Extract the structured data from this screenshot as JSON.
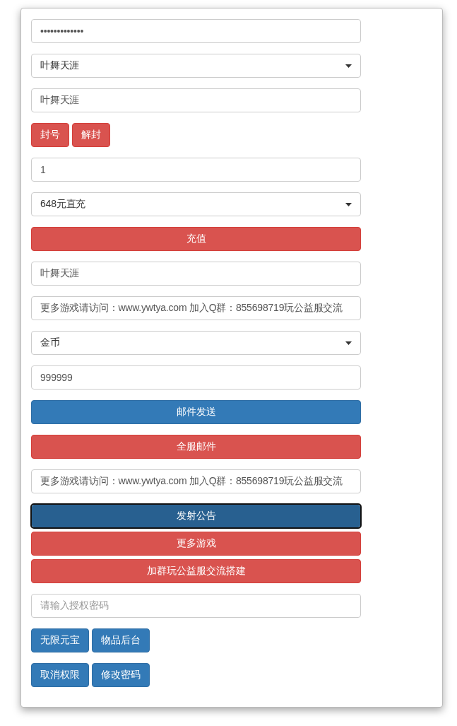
{
  "form": {
    "rows": [
      {
        "kind": "field",
        "value": "•••••••••••••"
      },
      {
        "kind": "select",
        "value": "叶舞天涯"
      },
      {
        "kind": "field",
        "value": "叶舞天涯"
      },
      {
        "kind": "buttons",
        "buttons": [
          {
            "label": "封号",
            "kind": "danger"
          },
          {
            "label": "解封",
            "kind": "danger"
          }
        ]
      },
      {
        "kind": "field",
        "value": "1"
      },
      {
        "kind": "select",
        "value": "648元直充"
      },
      {
        "kind": "stack",
        "buttons": [
          {
            "label": "充值",
            "kind": "danger",
            "focused": false
          }
        ]
      },
      {
        "kind": "field",
        "value": "叶舞天涯"
      },
      {
        "kind": "field",
        "value": "更多游戏请访问：www.ywtya.com  加入Q群：855698719玩公益服交流"
      },
      {
        "kind": "select",
        "value": "金币"
      },
      {
        "kind": "field",
        "value": "999999"
      },
      {
        "kind": "stack",
        "buttons": [
          {
            "label": "邮件发送",
            "kind": "primary",
            "focused": false
          }
        ]
      },
      {
        "kind": "stack",
        "buttons": [
          {
            "label": "全服邮件",
            "kind": "danger",
            "focused": false
          }
        ]
      },
      {
        "kind": "field",
        "value": "更多游戏请访问：www.ywtya.com  加入Q群：855698719玩公益服交流"
      },
      {
        "kind": "stack",
        "buttons": [
          {
            "label": "发射公告",
            "kind": "primary",
            "focused": true
          },
          {
            "label": "更多游戏",
            "kind": "danger",
            "focused": false
          },
          {
            "label": "加群玩公益服交流搭建",
            "kind": "danger",
            "focused": false
          }
        ]
      },
      {
        "kind": "field",
        "placeholder": "请输入授权密码"
      },
      {
        "kind": "buttons",
        "buttons": [
          {
            "label": "无限元宝",
            "kind": "primary"
          },
          {
            "label": "物品后台",
            "kind": "primary"
          }
        ]
      },
      {
        "kind": "buttons",
        "buttons": [
          {
            "label": "取消权限",
            "kind": "primary"
          },
          {
            "label": "修改密码",
            "kind": "primary"
          }
        ]
      }
    ]
  }
}
